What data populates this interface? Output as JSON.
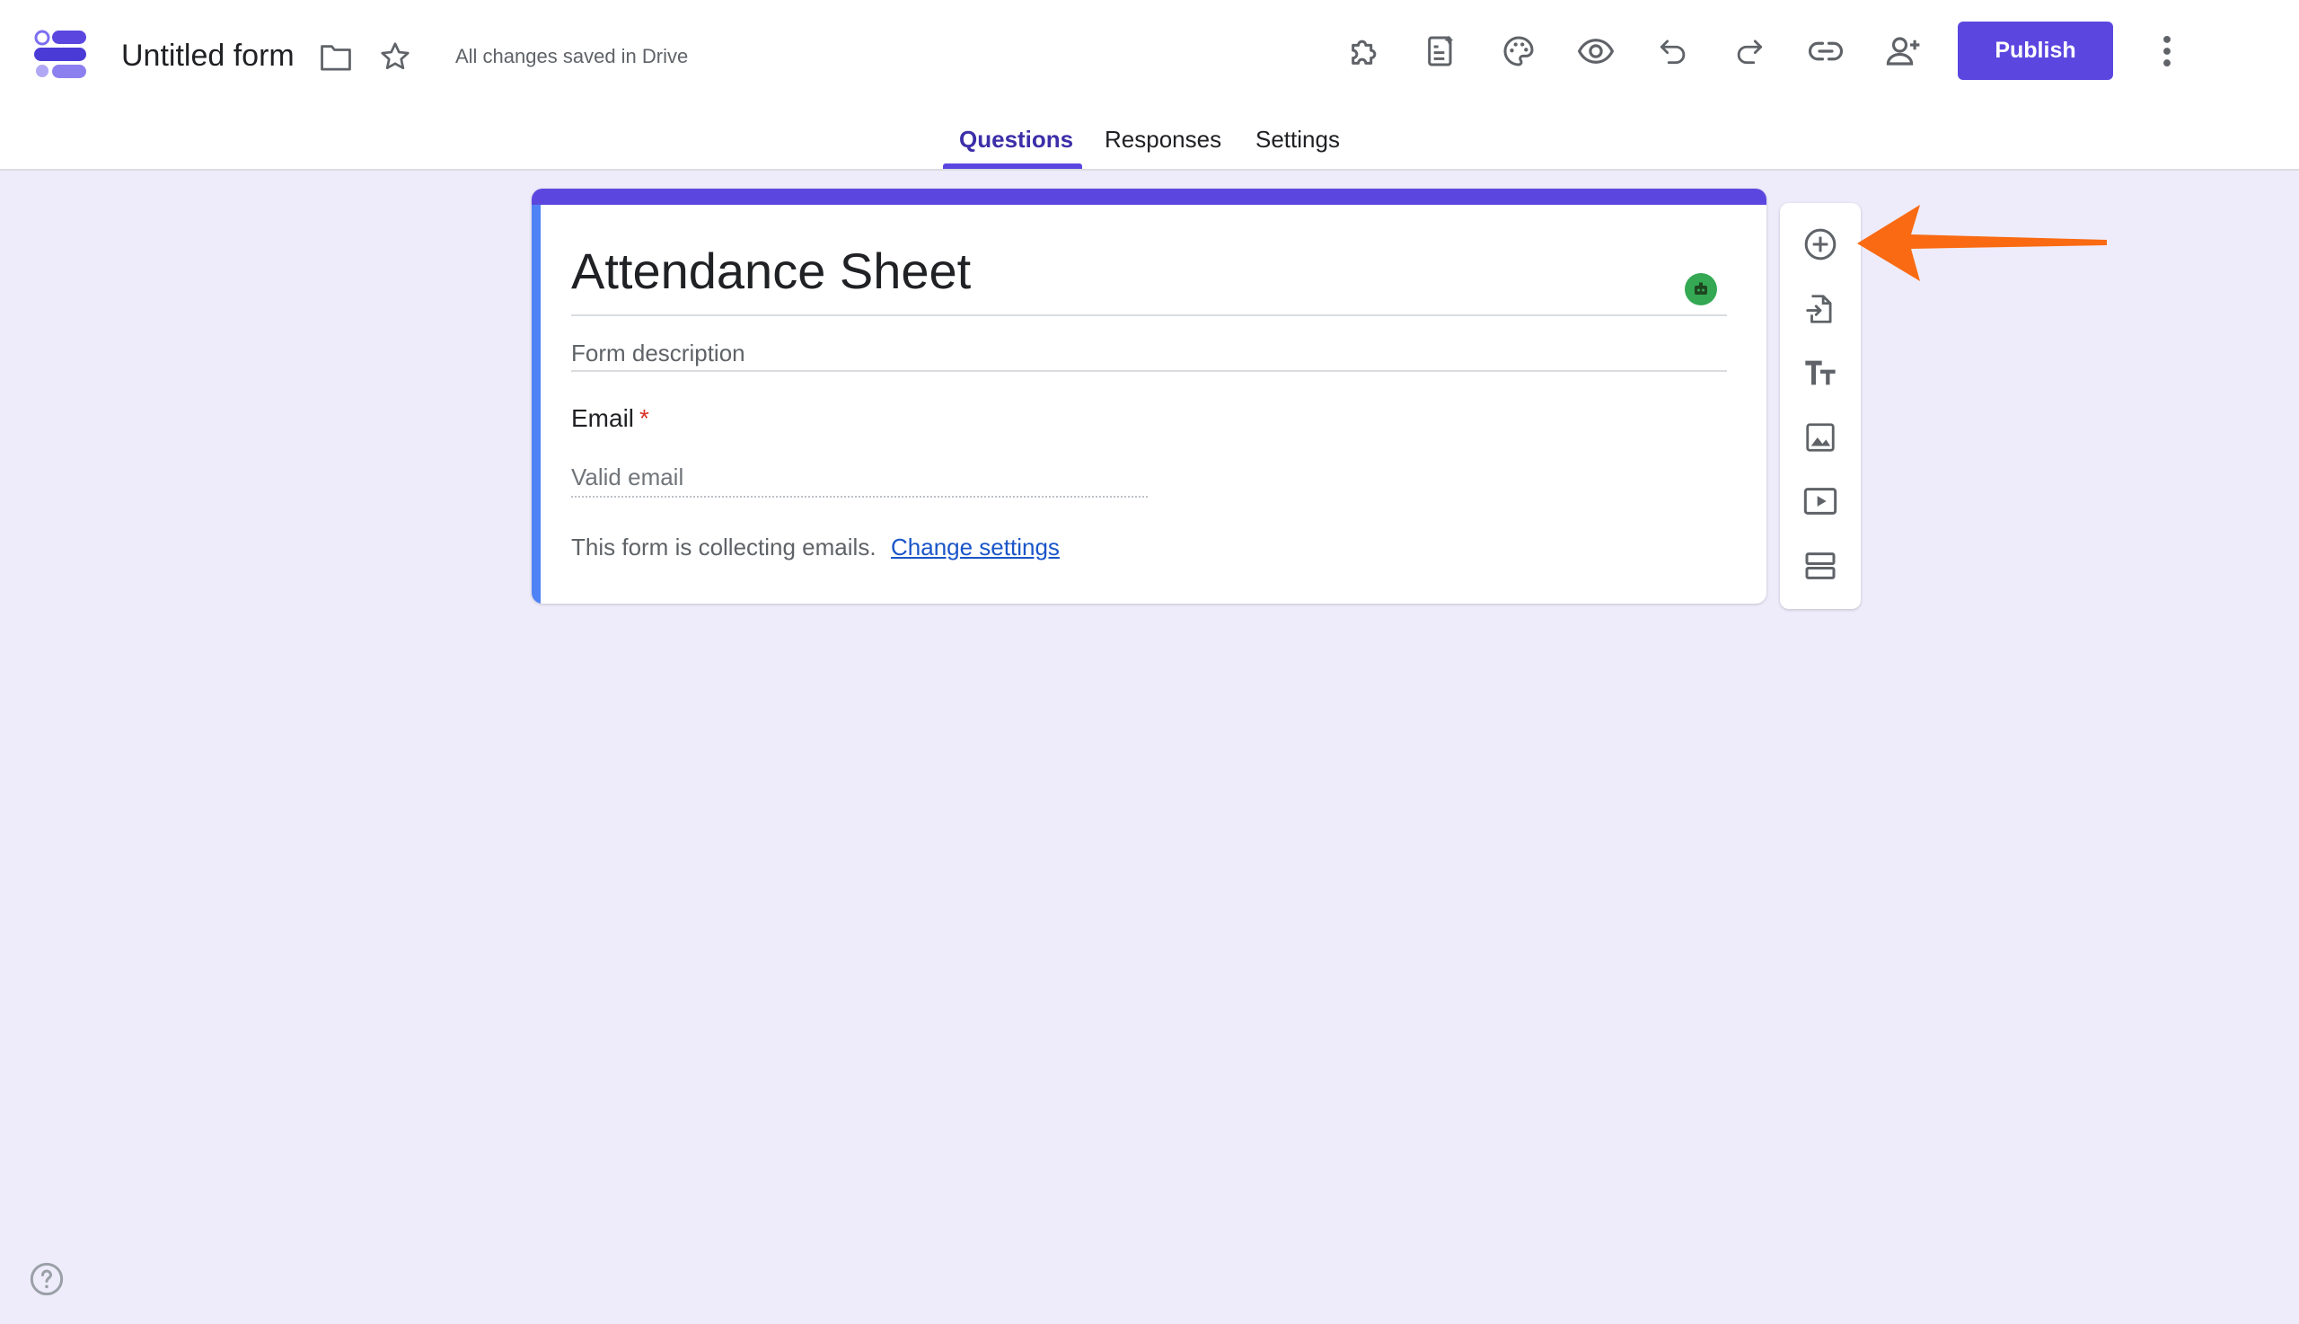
{
  "header": {
    "form_title": "Untitled form",
    "save_status": "All changes saved in Drive",
    "publish_label": "Publish",
    "icons": [
      "folder-icon",
      "star-icon",
      "addons-icon",
      "ai-icon",
      "palette-icon",
      "preview-icon",
      "undo-icon",
      "redo-icon",
      "link-icon",
      "add-collaborator-icon",
      "more-vert-icon"
    ]
  },
  "tabs": [
    {
      "label": "Questions",
      "active": true
    },
    {
      "label": "Responses",
      "active": false
    },
    {
      "label": "Settings",
      "active": false
    }
  ],
  "form": {
    "title": "Attendance Sheet",
    "description_placeholder": "Form description",
    "question": {
      "label": "Email",
      "required_mark": "*",
      "placeholder": "Valid email"
    },
    "collecting_text": "This form is collecting emails.",
    "change_settings_link": "Change settings"
  },
  "side_toolbar": [
    "add-question-icon",
    "import-questions-icon",
    "add-title-icon",
    "add-image-icon",
    "add-video-icon",
    "add-section-icon"
  ],
  "colors": {
    "accent": "#5b47e0",
    "page_bg": "#eeecfb",
    "card_left_border": "#4f83f5",
    "arrow": "#f96a12",
    "link": "#1a55c9"
  }
}
